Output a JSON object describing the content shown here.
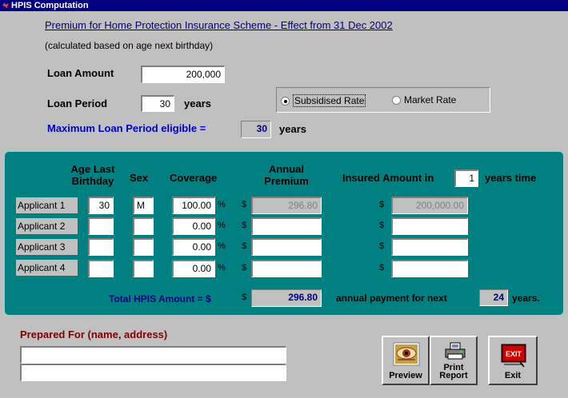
{
  "window": {
    "title": "HPIS Computation"
  },
  "heading": "Premium for Home Protection Insurance Scheme - Effect from 31 Dec 2002",
  "note": "(calculated based on age next birthday)",
  "loan": {
    "amount_label": "Loan Amount",
    "amount_value": "200,000",
    "period_label": "Loan Period",
    "period_value": "30",
    "period_unit": "years"
  },
  "rate": {
    "options": [
      {
        "label": "Subsidised Rate",
        "selected": true
      },
      {
        "label": "Market Rate",
        "selected": false
      }
    ]
  },
  "max_period": {
    "label": "Maximum Loan Period eligible =",
    "value": "30",
    "unit": "years"
  },
  "table": {
    "headers": {
      "age": "Age Last Birthday",
      "sex": "Sex",
      "coverage": "Coverage",
      "premium": "Annual Premium",
      "insured_prefix": "Insured Amount in",
      "insured_years": "1",
      "insured_suffix": "years time"
    },
    "percent_sign": "%",
    "dollar_sign": "$",
    "rows": [
      {
        "label": "Applicant 1",
        "age": "30",
        "sex": "M",
        "coverage": "100.00",
        "premium": "296.80",
        "insured": "200,000.00"
      },
      {
        "label": "Applicant 2",
        "age": "",
        "sex": "",
        "coverage": "0.00",
        "premium": "",
        "insured": ""
      },
      {
        "label": "Applicant 3",
        "age": "",
        "sex": "",
        "coverage": "0.00",
        "premium": "",
        "insured": ""
      },
      {
        "label": "Applicant 4",
        "age": "",
        "sex": "",
        "coverage": "0.00",
        "premium": "",
        "insured": ""
      }
    ],
    "total_label": "Total HPIS Amount = $",
    "total_value": "296.80",
    "payment_prefix": "annual payment for next",
    "payment_years": "24",
    "payment_suffix": "years."
  },
  "prepared": {
    "label": "Prepared For (name, address)",
    "line1": "",
    "line2": ""
  },
  "buttons": {
    "preview": "Preview",
    "print_line1": "Print",
    "print_line2": "Report",
    "exit": "Exit",
    "exit_icon_text": "EXIT"
  },
  "colors": {
    "panel": "#008080",
    "title_bar": "#000080",
    "heading": "#000080",
    "max_period_label": "#0000cc",
    "prepared_label": "#800000"
  }
}
